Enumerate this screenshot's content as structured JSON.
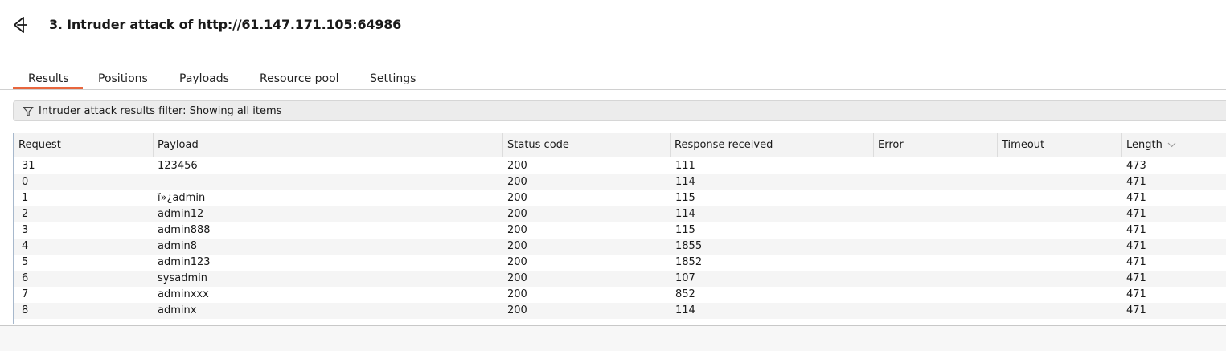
{
  "header": {
    "title": "3. Intruder attack of http://61.147.171.105:64986",
    "back_icon": "back-arrow-icon"
  },
  "tabs": [
    {
      "label": "Results",
      "active": true
    },
    {
      "label": "Positions",
      "active": false
    },
    {
      "label": "Payloads",
      "active": false
    },
    {
      "label": "Resource pool",
      "active": false
    },
    {
      "label": "Settings",
      "active": false
    }
  ],
  "filter": {
    "icon": "filter-icon",
    "text": "Intruder attack results filter: Showing all items"
  },
  "table": {
    "columns": [
      "Request",
      "Payload",
      "Status code",
      "Response received",
      "Error",
      "Timeout",
      "Length"
    ],
    "sort_column": "Length",
    "sort_direction": "descending",
    "rows": [
      [
        "31",
        "123456",
        "200",
        "111",
        "",
        "",
        "473"
      ],
      [
        "0",
        "",
        "200",
        "114",
        "",
        "",
        "471"
      ],
      [
        "1",
        "ï»¿admin",
        "200",
        "115",
        "",
        "",
        "471"
      ],
      [
        "2",
        "admin12",
        "200",
        "114",
        "",
        "",
        "471"
      ],
      [
        "3",
        "admin888",
        "200",
        "115",
        "",
        "",
        "471"
      ],
      [
        "4",
        "admin8",
        "200",
        "1855",
        "",
        "",
        "471"
      ],
      [
        "5",
        "admin123",
        "200",
        "1852",
        "",
        "",
        "471"
      ],
      [
        "6",
        "sysadmin",
        "200",
        "107",
        "",
        "",
        "471"
      ],
      [
        "7",
        "adminxxx",
        "200",
        "852",
        "",
        "",
        "471"
      ],
      [
        "8",
        "adminx",
        "200",
        "114",
        "",
        "",
        "471"
      ]
    ]
  },
  "colors": {
    "accent": "#e8663d",
    "table_border": "#a7b8cc"
  }
}
